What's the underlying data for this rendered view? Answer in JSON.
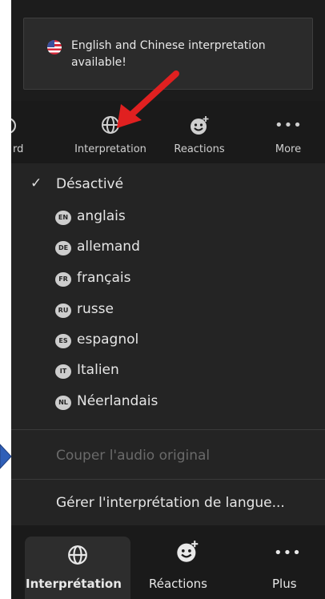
{
  "notification": {
    "text": "English and Chinese interpretation available!",
    "icon": "us-flag-icon"
  },
  "toolbar_top": {
    "partial_left_label": "rd",
    "interpretation_label": "Interpretation",
    "reactions_label": "Reactions",
    "more_label": "More"
  },
  "menu": {
    "off_label": "Désactivé",
    "languages": [
      {
        "code": "EN",
        "label": "anglais"
      },
      {
        "code": "DE",
        "label": "allemand"
      },
      {
        "code": "FR",
        "label": "français"
      },
      {
        "code": "RU",
        "label": "russe"
      },
      {
        "code": "ES",
        "label": "espagnol"
      },
      {
        "code": "IT",
        "label": "Italien"
      },
      {
        "code": "NL",
        "label": "Néerlandais"
      }
    ],
    "mute_original_label": "Couper l'audio original",
    "manage_label": "Gérer l'interprétation de langue..."
  },
  "toolbar_bottom": {
    "interpretation_label": "Interprétation",
    "reactions_label": "Réactions",
    "more_label": "Plus"
  },
  "colors": {
    "background": "#242424",
    "toolbar": "#1a1a1a",
    "annotation_arrow": "#e02020",
    "edge_arrow": "#2f5fb8"
  }
}
